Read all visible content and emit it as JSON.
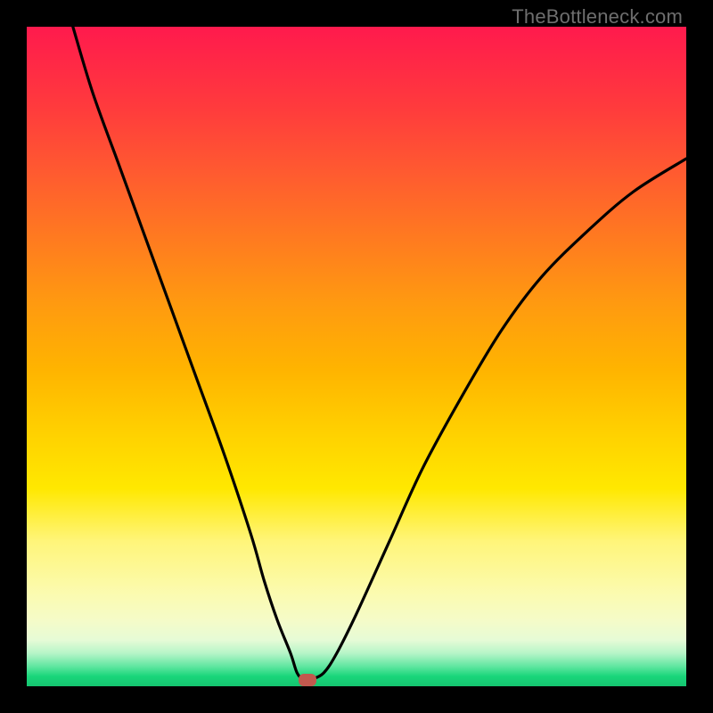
{
  "watermark": "TheBottleneck.com",
  "colors": {
    "frame": "#000000",
    "curve": "#000000",
    "marker": "#c1594e",
    "gradient_top": "#ff1a4d",
    "gradient_bottom": "#15c470"
  },
  "chart_data": {
    "type": "line",
    "title": "",
    "xlabel": "",
    "ylabel": "",
    "xlim": [
      0,
      100
    ],
    "ylim": [
      0,
      100
    ],
    "grid": false,
    "legend": false,
    "series": [
      {
        "name": "bottleneck-curve",
        "x": [
          7,
          10,
          14,
          18,
          22,
          26,
          30,
          34,
          36,
          38,
          40,
          41,
          42,
          43,
          45,
          47,
          50,
          55,
          60,
          66,
          72,
          78,
          85,
          92,
          100
        ],
        "y": [
          100,
          90,
          79,
          68,
          57,
          46,
          35,
          23,
          16,
          10,
          5,
          2,
          1,
          1,
          2,
          5,
          11,
          22,
          33,
          44,
          54,
          62,
          69,
          75,
          80
        ]
      }
    ],
    "annotations": [
      {
        "name": "minimum-marker",
        "x": 42.5,
        "y": 1
      }
    ],
    "background": "vertical-gradient red→orange→yellow→green",
    "notes": "V-shaped black curve over rainbow gradient; small rounded marker at the minimum near bottom."
  }
}
